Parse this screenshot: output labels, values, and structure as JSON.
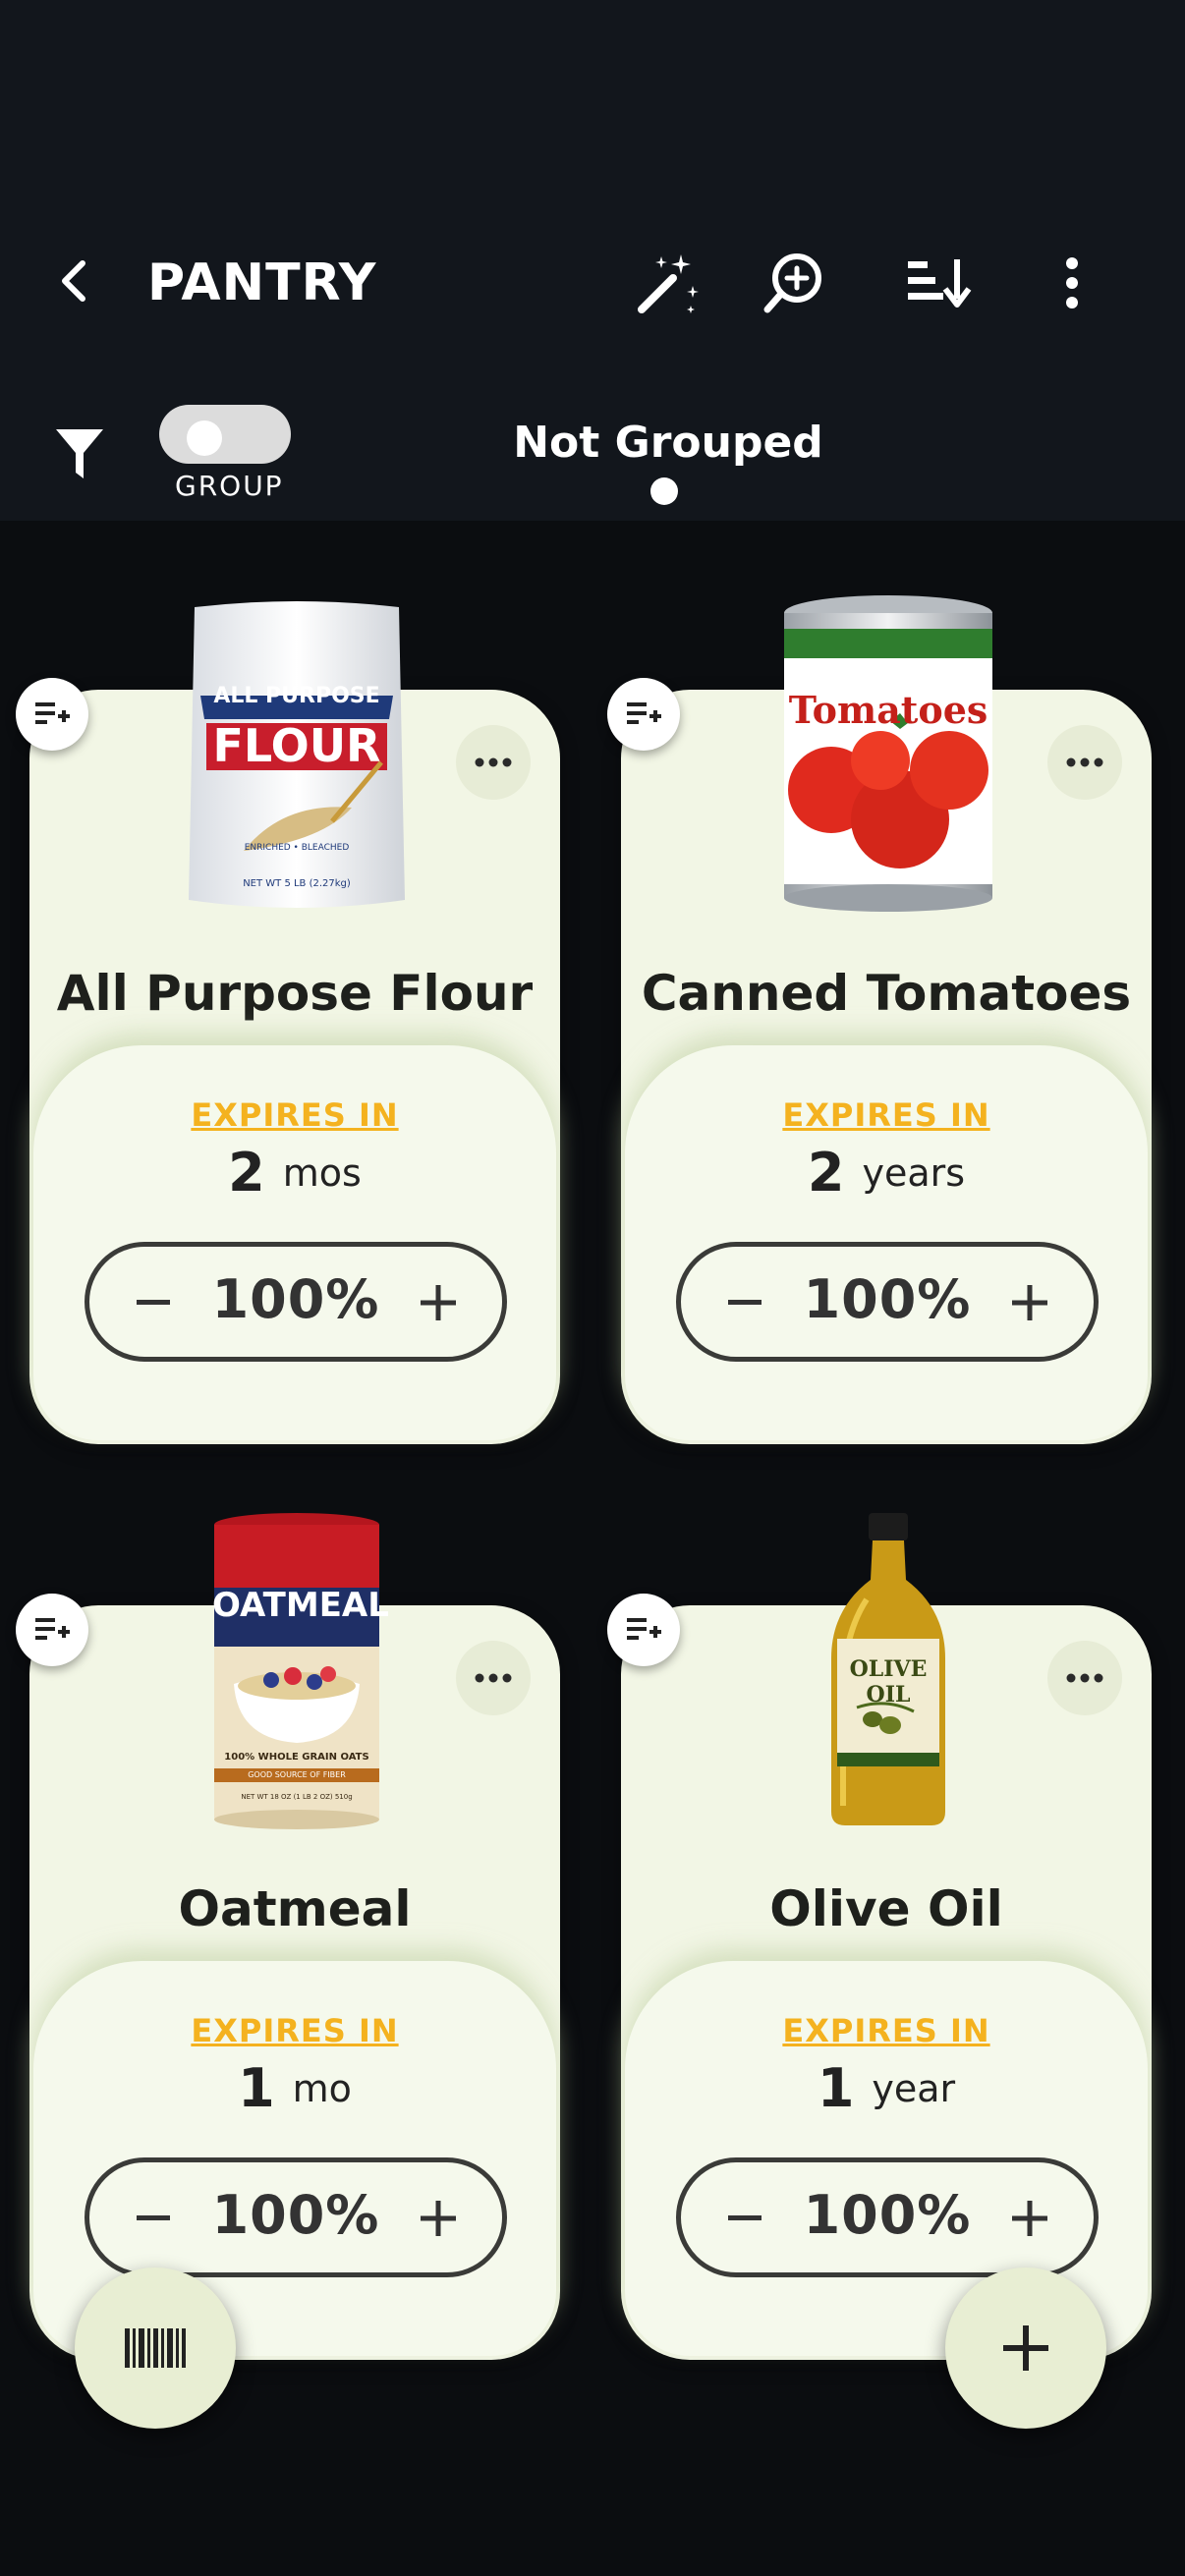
{
  "header": {
    "title": "PANTRY",
    "icons": [
      "back-arrow-icon",
      "magic-wand-icon",
      "zoom-in-icon",
      "sort-icon",
      "more-vertical-icon"
    ]
  },
  "controls": {
    "group_label": "GROUP",
    "group_toggle_on": false,
    "grouping_mode": "Not Grouped"
  },
  "items": [
    {
      "name": "All Purpose Flour",
      "expires_label": "EXPIRES IN",
      "expires_value": "2",
      "expires_unit": "mos",
      "quantity": "100%",
      "image_text": [
        "ALL PURPOSE",
        "FLOUR",
        "ENRICHED • BLEACHED",
        "NET WT 5 LB (2.27kg)"
      ]
    },
    {
      "name": "Canned Tomatoes",
      "expires_label": "EXPIRES IN",
      "expires_value": "2",
      "expires_unit": "years",
      "quantity": "100%",
      "image_text": [
        "Tomatoes"
      ]
    },
    {
      "name": "Oatmeal",
      "expires_label": "EXPIRES IN",
      "expires_value": "1",
      "expires_unit": "mo",
      "quantity": "100%",
      "image_text": [
        "OATMEAL",
        "100% WHOLE GRAIN OATS",
        "GOOD SOURCE OF FIBER",
        "NET WT 18 OZ (1 LB 2 OZ) 510g"
      ]
    },
    {
      "name": "Olive Oil",
      "expires_label": "EXPIRES IN",
      "expires_value": "1",
      "expires_unit": "year",
      "quantity": "100%",
      "image_text": [
        "OLIVE OIL"
      ]
    }
  ],
  "fabs": {
    "scan_icon": "barcode-icon",
    "add_icon": "plus-icon"
  },
  "colors": {
    "background": "#0b0d10",
    "header": "#12161c",
    "card": "#f2f6e5",
    "accent": "#f4b21f",
    "fab": "#e8eed3"
  }
}
